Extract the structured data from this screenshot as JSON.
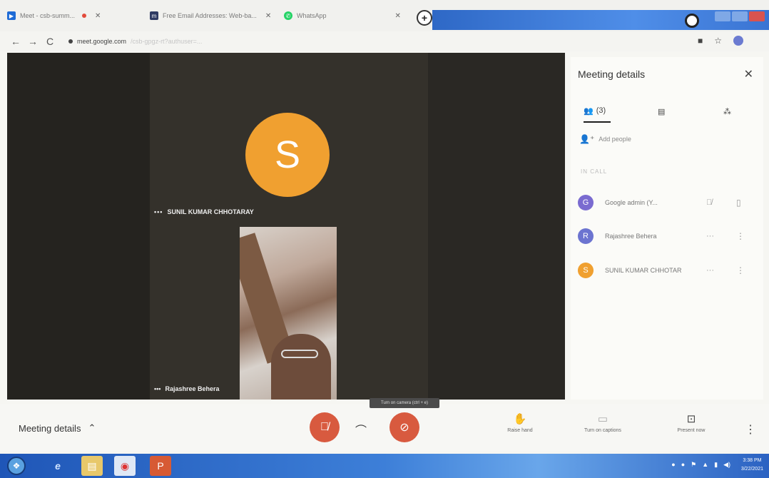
{
  "browser": {
    "tabs": [
      {
        "label": "Meet - csb-summ...",
        "favicon": "meet-icon",
        "fav_color": "#1e6bd6"
      },
      {
        "label": "Free Email Addresses: Web-ba...",
        "favicon": "mail-icon",
        "fav_color": "#2f3b63"
      },
      {
        "label": "WhatsApp",
        "favicon": "whatsapp-icon",
        "fav_color": "#25d366"
      }
    ],
    "url_host": "meet.google.com",
    "url_path": "/csb-gpgz-rt?authuser=..."
  },
  "meeting": {
    "main_participant_initial": "S",
    "main_participant_name": "SUNIL KUMAR CHHOTARAY",
    "self_view_name": "Rajashree Behera"
  },
  "side_panel": {
    "title": "Meeting details",
    "people_tab_count": "(3)",
    "add_people_label": "Add people",
    "in_call_label": "IN CALL",
    "participants": [
      {
        "initial": "G",
        "name": "Google admin (Y...",
        "color": "#7a6bd0"
      },
      {
        "initial": "R",
        "name": "Rajashree Behera",
        "color": "#6c74d0"
      },
      {
        "initial": "S",
        "name": "SUNIL KUMAR CHHOTAR",
        "color": "#f0a030"
      }
    ]
  },
  "controls": {
    "meeting_details_label": "Meeting details",
    "tooltip": "Turn on camera (ctrl + e)",
    "raise_hand_label": "Raise hand",
    "captions_label": "Turn on captions",
    "present_label": "Present now"
  },
  "taskbar": {
    "clock_time": "3:38 PM",
    "clock_date": "3/22/2021"
  }
}
